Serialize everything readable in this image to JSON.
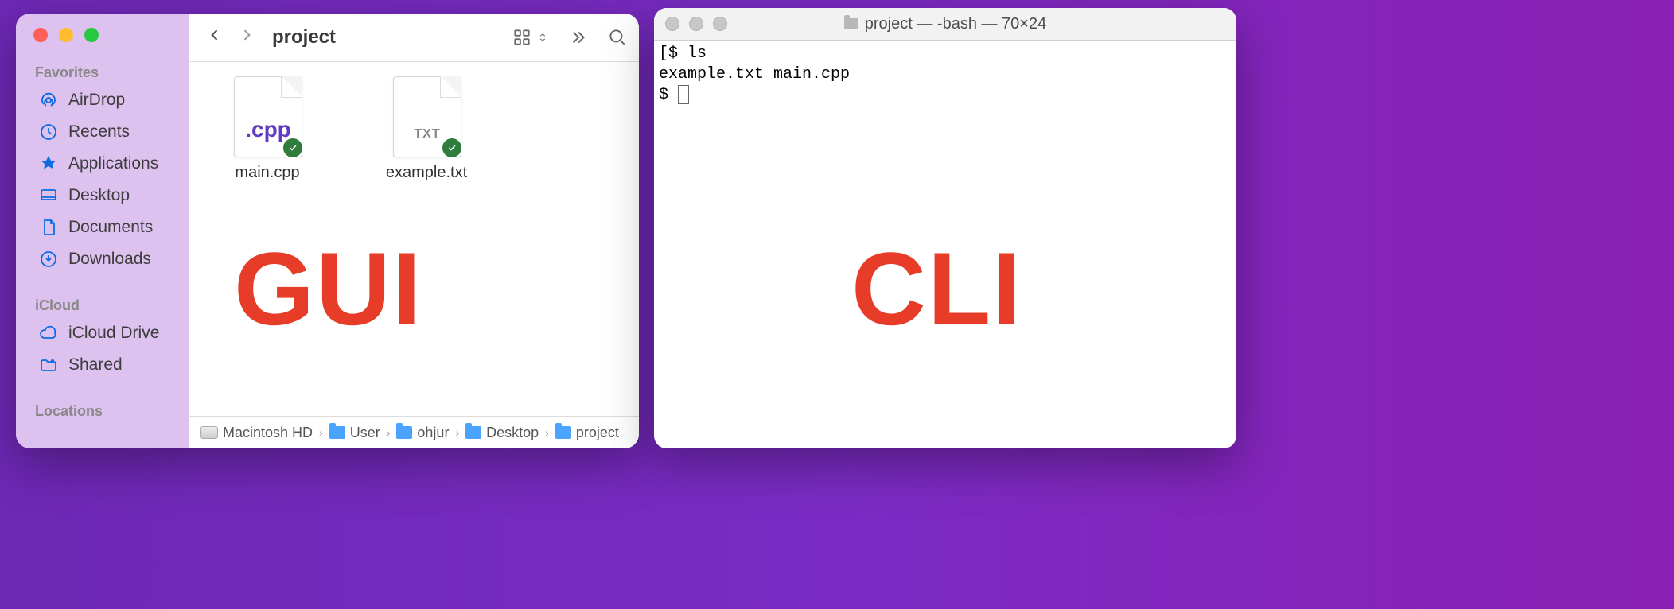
{
  "finder": {
    "title": "project",
    "sidebar": {
      "sections": [
        {
          "title": "Favorites",
          "items": [
            {
              "label": "AirDrop",
              "icon": "airdrop"
            },
            {
              "label": "Recents",
              "icon": "clock"
            },
            {
              "label": "Applications",
              "icon": "apps"
            },
            {
              "label": "Desktop",
              "icon": "desktop"
            },
            {
              "label": "Documents",
              "icon": "doc"
            },
            {
              "label": "Downloads",
              "icon": "download"
            }
          ]
        },
        {
          "title": "iCloud",
          "items": [
            {
              "label": "iCloud Drive",
              "icon": "cloud"
            },
            {
              "label": "Shared",
              "icon": "shared"
            }
          ]
        },
        {
          "title": "Locations",
          "items": []
        }
      ]
    },
    "files": [
      {
        "name": "main.cpp",
        "ext_label": ".cpp",
        "kind": "cpp",
        "synced": true
      },
      {
        "name": "example.txt",
        "ext_label": "TXT",
        "kind": "txt",
        "synced": true
      }
    ],
    "pathbar": [
      {
        "label": "Macintosh HD",
        "icon": "hdd"
      },
      {
        "label": "User",
        "icon": "folder"
      },
      {
        "label": "ohjur",
        "icon": "folder"
      },
      {
        "label": "Desktop",
        "icon": "folder"
      },
      {
        "label": "project",
        "icon": "folder"
      }
    ]
  },
  "terminal": {
    "title": "project — -bash — 70×24",
    "lines": [
      "[$ ls",
      "example.txt main.cpp",
      "$ "
    ]
  },
  "overlays": {
    "gui": "GUI",
    "cli": "CLI"
  }
}
